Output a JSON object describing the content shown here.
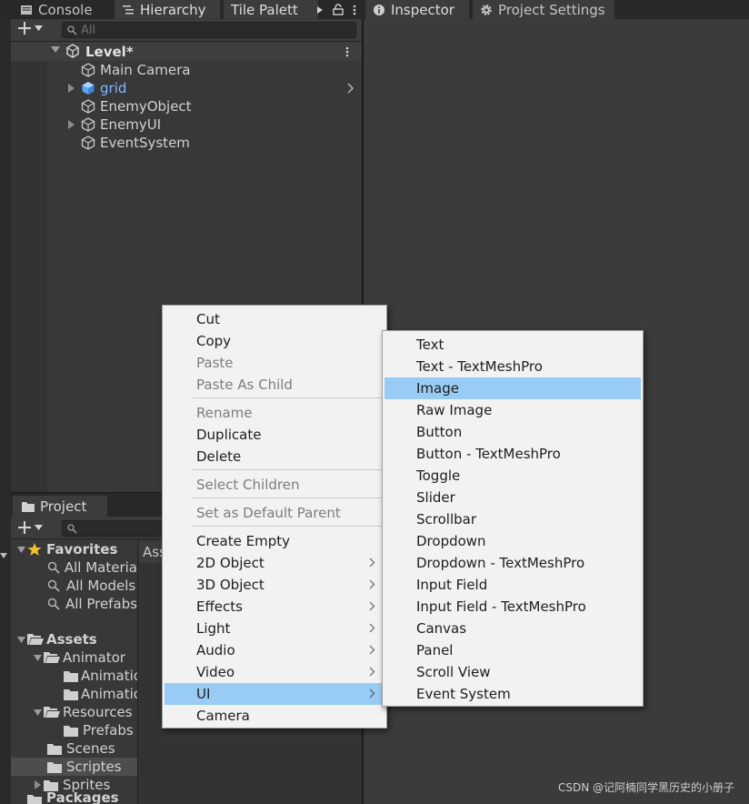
{
  "top_tabs": {
    "console": "Console",
    "hierarchy": "Hierarchy",
    "tile_palette": "Tile Palett",
    "inspector": "Inspector",
    "project_settings": "Project Settings"
  },
  "hierarchy": {
    "search_placeholder": "All",
    "scene": "Level*",
    "items": [
      "Main Camera",
      "grid",
      "EnemyObject",
      "EnemyUI",
      "EventSystem"
    ]
  },
  "project": {
    "tab": "Project",
    "assets_path": "Ass",
    "tree": [
      "Favorites",
      "All Materia",
      "All Models",
      "All Prefabs",
      "Assets",
      "Animator",
      "Animatio",
      "Animatio",
      "Resources",
      "Prefabs",
      "Scenes",
      "Scriptes",
      "Sprites",
      "Packages"
    ]
  },
  "context_menu": {
    "items": [
      "Cut",
      "Copy",
      "Paste",
      "Paste As Child",
      "Rename",
      "Duplicate",
      "Delete",
      "Select Children",
      "Set as Default Parent",
      "Create Empty",
      "2D Object",
      "3D Object",
      "Effects",
      "Light",
      "Audio",
      "Video",
      "UI",
      "Camera"
    ]
  },
  "ui_submenu": {
    "items": [
      "Text",
      "Text - TextMeshPro",
      "Image",
      "Raw Image",
      "Button",
      "Button - TextMeshPro",
      "Toggle",
      "Slider",
      "Scrollbar",
      "Dropdown",
      "Dropdown - TextMeshPro",
      "Input Field",
      "Input Field - TextMeshPro",
      "Canvas",
      "Panel",
      "Scroll View",
      "Event System"
    ],
    "highlighted": "Image"
  },
  "colors": {
    "highlight": "#99ccf5",
    "favorite_star": "#f2c12e",
    "prefab_blue": "#7fb7ff"
  },
  "watermark": "CSDN @记阿楠同学黑历史的小册子"
}
